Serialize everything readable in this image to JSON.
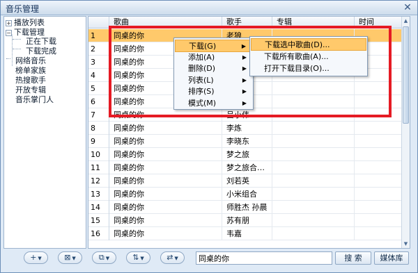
{
  "window": {
    "title": "音乐管理",
    "close_glyph": "✕"
  },
  "tree": {
    "items": [
      {
        "label": "播放列表",
        "expander": "+"
      },
      {
        "label": "下载管理",
        "expander": "−"
      },
      {
        "label": "正在下载"
      },
      {
        "label": "下载完成"
      },
      {
        "label": "网络音乐"
      },
      {
        "label": "榜单家族"
      },
      {
        "label": "热搜歌手"
      },
      {
        "label": "开放专辑"
      },
      {
        "label": "音乐掌门人"
      }
    ]
  },
  "grid": {
    "columns": [
      "",
      "歌曲",
      "歌手",
      "专辑",
      "时间"
    ],
    "rows": [
      {
        "num": "1",
        "song": "同桌的你",
        "artist": "老狼",
        "album": "",
        "time": ""
      },
      {
        "num": "2",
        "song": "同桌的你",
        "artist": "",
        "album": "",
        "time": ""
      },
      {
        "num": "3",
        "song": "同桌的你",
        "artist": "",
        "album": "",
        "time": ""
      },
      {
        "num": "4",
        "song": "同桌的你",
        "artist": "",
        "album": "",
        "time": ""
      },
      {
        "num": "5",
        "song": "同桌的你",
        "artist": "",
        "album": "",
        "time": ""
      },
      {
        "num": "6",
        "song": "同桌的你",
        "artist": "",
        "album": "",
        "time": ""
      },
      {
        "num": "7",
        "song": "同桌的你",
        "artist": "吕小伟",
        "album": "",
        "time": ""
      },
      {
        "num": "8",
        "song": "同桌的你",
        "artist": "李炼",
        "album": "",
        "time": ""
      },
      {
        "num": "9",
        "song": "同桌的你",
        "artist": "李晓东",
        "album": "",
        "time": ""
      },
      {
        "num": "10",
        "song": "同桌的你",
        "artist": "梦之旅",
        "album": "",
        "time": ""
      },
      {
        "num": "11",
        "song": "同桌的你",
        "artist": "梦之旅合…",
        "album": "",
        "time": ""
      },
      {
        "num": "12",
        "song": "同桌的你",
        "artist": "刘若英",
        "album": "",
        "time": ""
      },
      {
        "num": "13",
        "song": "同桌的你",
        "artist": "小米组合",
        "album": "",
        "time": ""
      },
      {
        "num": "14",
        "song": "同桌的你",
        "artist": "师胜杰 孙晨",
        "album": "",
        "time": ""
      },
      {
        "num": "15",
        "song": "同桌的你",
        "artist": "苏有朋",
        "album": "",
        "time": ""
      },
      {
        "num": "16",
        "song": "同桌的你",
        "artist": "韦嘉",
        "album": "",
        "time": ""
      }
    ],
    "selected_row": "1"
  },
  "context_menu": {
    "items": [
      {
        "label": "下载(G)",
        "submenu": true
      },
      {
        "label": "添加(A)",
        "submenu": true
      },
      {
        "label": "删除(D)",
        "submenu": true
      },
      {
        "label": "列表(L)",
        "submenu": true
      },
      {
        "label": "排序(S)",
        "submenu": true
      },
      {
        "label": "模式(M)",
        "submenu": true
      }
    ],
    "arrow_glyph": "▶"
  },
  "submenu": {
    "items": [
      {
        "label": "下载选中歌曲(D)..."
      },
      {
        "label": "下载所有歌曲(A)..."
      },
      {
        "label": "打开下载目录(O)..."
      }
    ]
  },
  "toolbar": {
    "buttons": [
      {
        "glyph": "+",
        "caret": "▼"
      },
      {
        "glyph": "⊠",
        "caret": "▼"
      },
      {
        "glyph": "⧉",
        "caret": "▼"
      },
      {
        "glyph": "⇅",
        "caret": "▼"
      },
      {
        "glyph": "⇄",
        "caret": "▼"
      }
    ],
    "search_value": "同桌的你",
    "search_button": "搜 索",
    "library_button": "媒体库"
  },
  "colors": {
    "selection": "#ffc96b",
    "highlight_frame": "#e51b24",
    "frame": "#6c8fb8"
  }
}
